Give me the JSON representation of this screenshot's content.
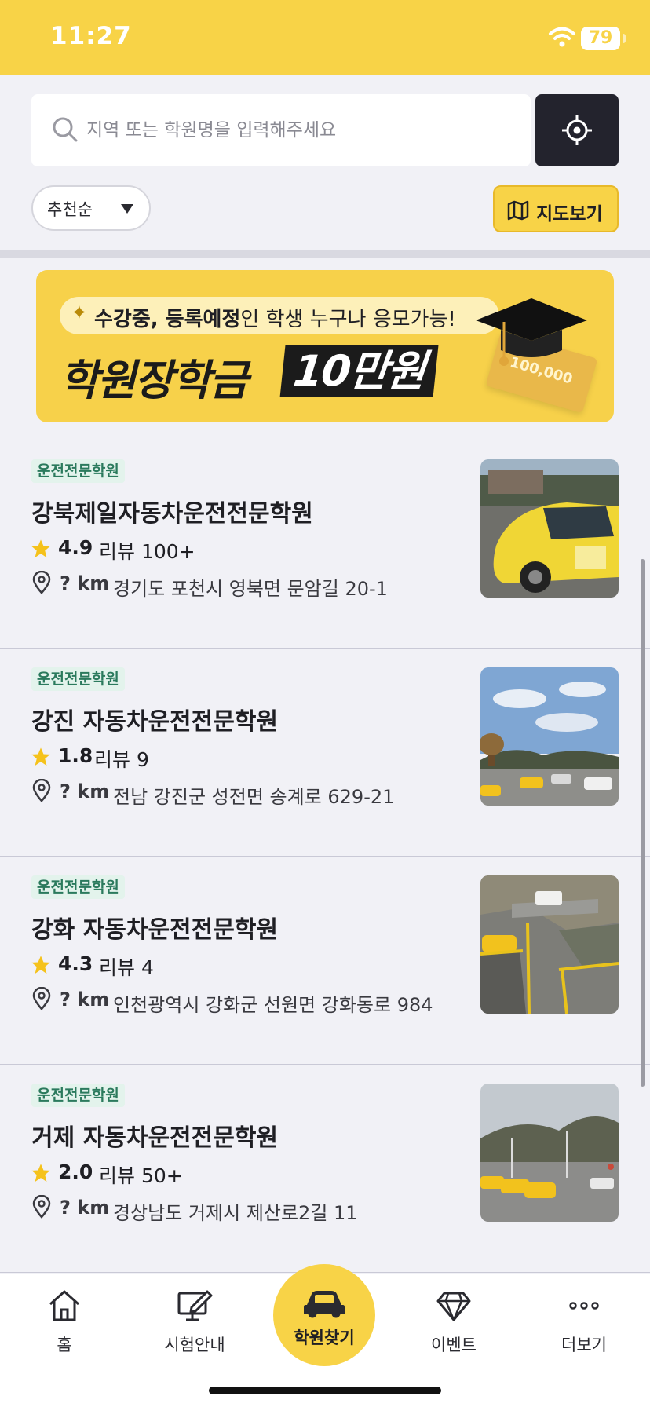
{
  "status_bar": {
    "time": "11:27",
    "battery": "79"
  },
  "search": {
    "placeholder": "지역 또는 학원명을 입력해주세요"
  },
  "filters": {
    "sort_label": "추천순",
    "map_label": "지도보기"
  },
  "banner": {
    "spark": "✦",
    "sub_bold_1": "수강중",
    "sub_comma": ", ",
    "sub_bold_2": "등록예정",
    "sub_rest": "인 학생 누구나 응모가능!",
    "title": "학원장학금",
    "amount": "10만원",
    "card_text": "100,000"
  },
  "academies": [
    {
      "tag": "운전전문학원",
      "name": "강북제일자동차운전전문학원",
      "rating": "4.9",
      "reviews": "리뷰 100+",
      "distance": "? km",
      "address": "경기도 포천시 영북면 문암길 20-1"
    },
    {
      "tag": "운전전문학원",
      "name": "강진 자동차운전전문학원",
      "rating": "1.8",
      "reviews": "리뷰 9",
      "distance": "? km",
      "address": "전남 강진군 성전면 송계로 629-21"
    },
    {
      "tag": "운전전문학원",
      "name": "강화 자동차운전전문학원",
      "rating": "4.3",
      "reviews": "리뷰 4",
      "distance": "? km",
      "address": "인천광역시 강화군 선원면 강화동로 984"
    },
    {
      "tag": "운전전문학원",
      "name": "거제 자동차운전전문학원",
      "rating": "2.0",
      "reviews": "리뷰 50+",
      "distance": "? km",
      "address": "경상남도 거제시 제산로2길 11"
    }
  ],
  "tabbar": {
    "home": "홈",
    "exam_info": "시험안내",
    "find_academy": "학원찾기",
    "events": "이벤트",
    "more": "더보기"
  },
  "colors": {
    "brand_yellow": "#f8d347",
    "dark": "#23232d",
    "tag_green": "#2b7a5d",
    "star": "#f5c21b"
  }
}
